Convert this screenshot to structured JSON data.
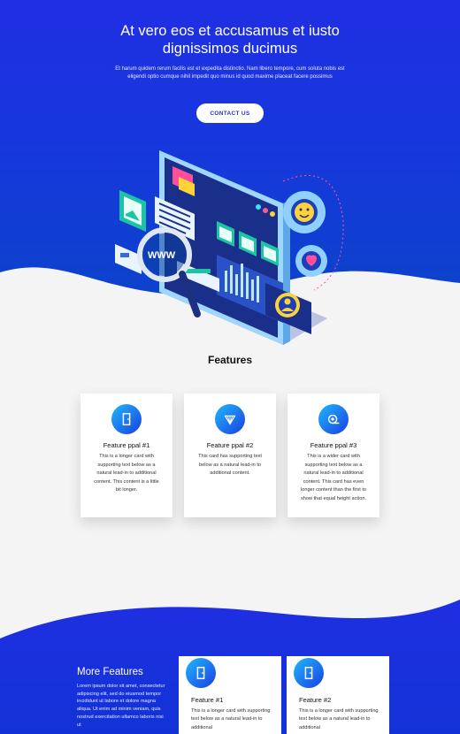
{
  "hero": {
    "title_line1": "At vero eos et accusamus et iusto",
    "title_line2": "dignissimos ducimus",
    "subtitle": "Et harum quidem rerum facilis est et expedita distinctio. Nam libero tempore, cum soluta nobis est eligendi optio cumque nihil impedit quo minus id quod maxime placeat facere possimus",
    "contact_label": "CONTACT US",
    "illustration_text": "WWW"
  },
  "features": {
    "title": "Features",
    "cards": [
      {
        "title": "Feature ppal #1",
        "text": "This is a longer card with supporting text below as a natural lead-in to additional content. This content is a little bit longer.",
        "icon": "door-icon"
      },
      {
        "title": "Feature ppal #2",
        "text": "This card has supporting text below as a natural lead-in to additional content.",
        "icon": "fan-icon"
      },
      {
        "title": "Feature ppal #3",
        "text": "This is a wider card with supporting text below as a natural lead-in to additional content. This card has even longer content than the first to show that equal height action.",
        "icon": "tape-icon"
      }
    ]
  },
  "more_features": {
    "title": "More Features",
    "text": "Lorem ipsum dolor sit amet, consectetur adipiscing elit, sed do eiusmod tempor incididunt ut labore et dolore magna aliqua. Ut enim ad minim veniam, quis nostrud exercitation ullamco laboris nisi ut",
    "cards": [
      {
        "title": "Feature #1",
        "text": "This is a longer card with supporting text below as a natural lead-in to additional",
        "icon": "door-icon"
      },
      {
        "title": "Feature #2",
        "text": "This is a longer card with supporting text below as a natural lead-in to additional",
        "icon": "door-icon"
      }
    ]
  },
  "colors": {
    "primary_blue": "#1f2fe2",
    "accent_cyan": "#1fb8ff",
    "background": "#f4f4f4"
  }
}
